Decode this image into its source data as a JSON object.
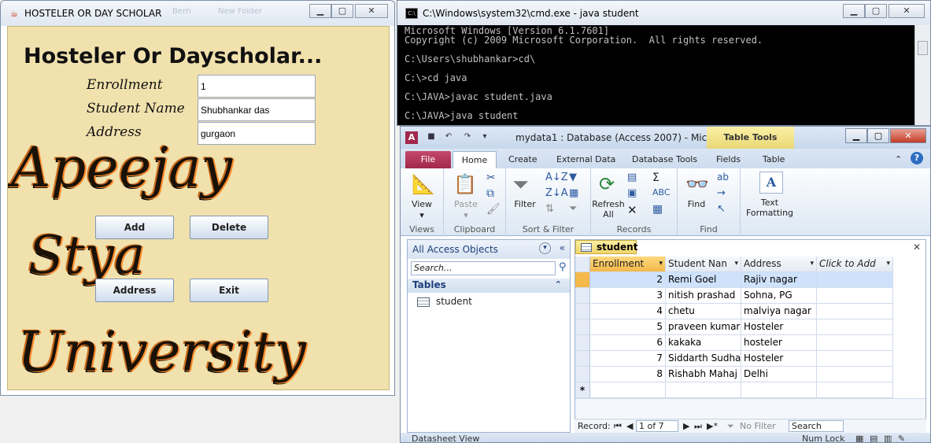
{
  "swing": {
    "title": "HOSTELER OR DAY SCHOLAR",
    "heading": "Hosteler Or Dayscholar...",
    "labels": {
      "enrollment": "Enrollment",
      "student_name": "Student Name",
      "address": "Address"
    },
    "fields": {
      "enrollment": "1",
      "student_name": "Shubhankar das",
      "address": "gurgaon"
    },
    "buttons": {
      "add": "Add",
      "delete": "Delete",
      "address": "Address",
      "exit": "Exit"
    },
    "background_script": [
      "Apeejay",
      "Stya",
      "University"
    ],
    "bg_faint": {
      "a": "Berri",
      "b": "New Folder"
    }
  },
  "cmd": {
    "title": "C:\\Windows\\system32\\cmd.exe - java  student",
    "lines": [
      "Microsoft Windows [Version 6.1.7601]",
      "Copyright (c) 2009 Microsoft Corporation.  All rights reserved.",
      "",
      "C:\\Users\\shubhankar>cd\\",
      "",
      "C:\\>cd java",
      "",
      "C:\\JAVA>javac student.java",
      "",
      "C:\\JAVA>java student"
    ]
  },
  "access": {
    "title": "mydata1 : Database (Access 2007)  -  Micr...",
    "table_tools": "Table Tools",
    "tabs": [
      "File",
      "Home",
      "Create",
      "External Data",
      "Database Tools",
      "Fields",
      "Table"
    ],
    "ribbon": {
      "view": "View",
      "paste": "Paste",
      "filter": "Filter",
      "refresh": "Refresh",
      "refresh_all": "All",
      "find": "Find",
      "text": "Text",
      "formatting": "Formatting",
      "groups": {
        "views": "Views",
        "clipboard": "Clipboard",
        "sort_filter": "Sort & Filter",
        "records": "Records",
        "find": "Find"
      }
    },
    "nav": {
      "header": "All Access Objects",
      "search_placeholder": "Search...",
      "section": "Tables",
      "items": [
        "student"
      ]
    },
    "doc_tab": "student",
    "grid": {
      "headers": [
        "Enrollment",
        "Student Nan",
        "Address",
        "Click to Add"
      ],
      "rows": [
        {
          "enrollment": "2",
          "name": "Remi Goel",
          "address": "Rajiv nagar"
        },
        {
          "enrollment": "3",
          "name": "nitish prashad",
          "address": "Sohna, PG"
        },
        {
          "enrollment": "4",
          "name": "chetu",
          "address": "malviya nagar"
        },
        {
          "enrollment": "5",
          "name": "praveen kumar",
          "address": "Hosteler"
        },
        {
          "enrollment": "6",
          "name": "kakaka",
          "address": "hosteler"
        },
        {
          "enrollment": "7",
          "name": "Siddarth Sudha",
          "address": "Hosteler"
        },
        {
          "enrollment": "8",
          "name": "Rishabh Mahaj",
          "address": "Delhi"
        }
      ],
      "new_row_marker": "*"
    },
    "record_nav": {
      "label": "Record:",
      "position": "1 of 7",
      "filter": "No Filter",
      "search": "Search"
    },
    "status": {
      "left": "Datasheet View",
      "right": "Num Lock"
    },
    "colors": {
      "file_tab": "#a1284c",
      "table_tools": "#f1d56a",
      "selected_header": "#f4b84b"
    }
  }
}
